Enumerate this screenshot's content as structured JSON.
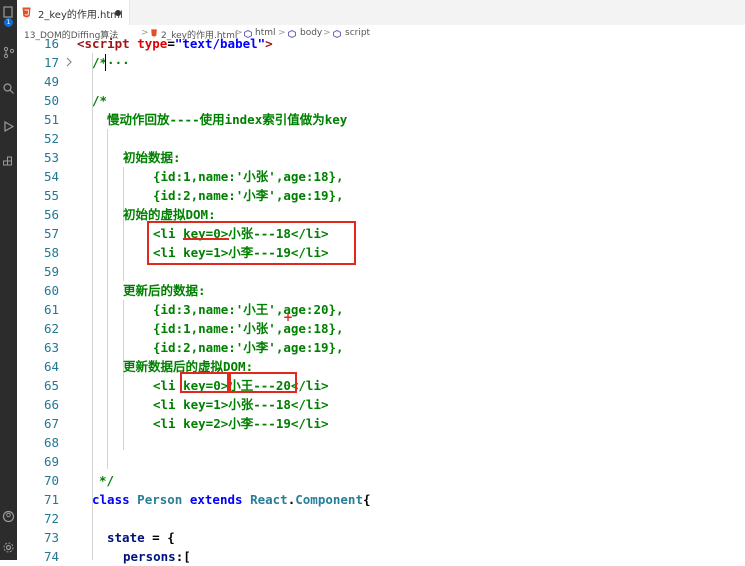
{
  "tab": {
    "label": "2_key的作用.html",
    "modified_indicator": "●"
  },
  "activity": {
    "badge": "1"
  },
  "breadcrumb": {
    "items": [
      "13_DOM的Diffing算法",
      "2_key的作用.html",
      "html",
      "body",
      "script"
    ],
    "separator": ">"
  },
  "lines": [
    {
      "num": "16",
      "text": "<script type=\"text/babel\">"
    },
    {
      "num": "17",
      "text": "/*···"
    },
    {
      "num": "49",
      "text": ""
    },
    {
      "num": "50",
      "text": "/*"
    },
    {
      "num": "51",
      "text": "慢动作回放----使用index索引值做为key"
    },
    {
      "num": "52",
      "text": ""
    },
    {
      "num": "53",
      "text": "初始数据:"
    },
    {
      "num": "54",
      "text": "{id:1,name:'小张',age:18},"
    },
    {
      "num": "55",
      "text": "{id:2,name:'小李',age:19},"
    },
    {
      "num": "56",
      "text": "初始的虚拟DOM:"
    },
    {
      "num": "57",
      "text": "<li key=0>小张---18</li>"
    },
    {
      "num": "58",
      "text": "<li key=1>小李---19</li>"
    },
    {
      "num": "59",
      "text": ""
    },
    {
      "num": "60",
      "text": "更新后的数据:"
    },
    {
      "num": "61",
      "text": "{id:3,name:'小王',age:20},"
    },
    {
      "num": "62",
      "text": "{id:1,name:'小张',age:18},"
    },
    {
      "num": "63",
      "text": "{id:2,name:'小李',age:19},"
    },
    {
      "num": "64",
      "text": "更新数据后的虚拟DOM:"
    },
    {
      "num": "65",
      "text": "<li key=0>小王---20</li>"
    },
    {
      "num": "66",
      "text": "<li key=1>小张---18</li>"
    },
    {
      "num": "67",
      "text": "<li key=2>小李---19</li>"
    },
    {
      "num": "68",
      "text": ""
    },
    {
      "num": "69",
      "text": ""
    },
    {
      "num": "70",
      "text": "*/"
    },
    {
      "num": "71",
      "text": "class Person extends React.Component{"
    },
    {
      "num": "72",
      "text": ""
    },
    {
      "num": "73",
      "text": "state = {"
    },
    {
      "num": "74",
      "text": "persons:["
    }
  ],
  "code": {
    "l16_a": "<script ",
    "l16_b": "type",
    "l16_c": "=",
    "l16_d": "\"text/babel\"",
    "l16_e": ">",
    "l71_class": "class",
    "l71_name": "Person",
    "l71_extends": "extends",
    "l71_react": "React",
    "l71_dot": ".",
    "l71_comp": "Component",
    "l71_brace": "{",
    "l73_state": "state",
    "l73_rest": " = {",
    "l74_persons": "persons",
    "l74_rest": ":["
  },
  "annotations": {
    "plus": "+"
  },
  "colors": {
    "comment": "#008000",
    "keyword": "#0000ff",
    "type": "#267f99",
    "annotation_red": "#e0281c"
  }
}
